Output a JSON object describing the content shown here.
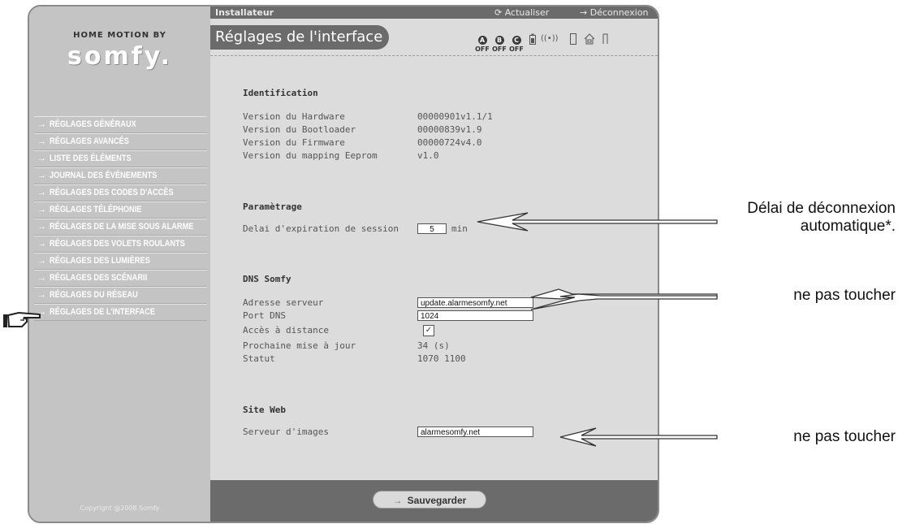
{
  "brand": {
    "line1": "HOME MOTION BY",
    "logo": "somfy."
  },
  "menu": {
    "items": [
      {
        "label": "RÉGLAGES GÉNÉRAUX"
      },
      {
        "label": "RÉGLAGES AVANCÉS"
      },
      {
        "label": "LISTE DES ÉLÉMENTS"
      },
      {
        "label": "JOURNAL DES ÉVÉNEMENTS"
      },
      {
        "label": "RÉGLAGES DES CODES D'ACCÈS"
      },
      {
        "label": "RÉGLAGES TÉLÉPHONIE"
      },
      {
        "label": "RÉGLAGES DE LA MISE SOUS ALARME"
      },
      {
        "label": "RÉGLAGES DES VOLETS ROULANTS"
      },
      {
        "label": "RÉGLAGES DES LUMIÈRES"
      },
      {
        "label": "RÉGLAGES DES SCÉNARII"
      },
      {
        "label": "RÉGLAGES DU RÉSEAU"
      },
      {
        "label": "RÉGLAGES DE L'INTERFACE"
      }
    ],
    "arrow": "→"
  },
  "copyright": "Copyright @2008 Somfy",
  "topbar": {
    "role": "Installateur",
    "refresh": "Actualiser",
    "logout": "Déconnexion"
  },
  "header": {
    "title": "Réglages de l'interface",
    "zones": [
      {
        "letter": "A",
        "state": "OFF"
      },
      {
        "letter": "B",
        "state": "OFF"
      },
      {
        "letter": "C",
        "state": "OFF"
      }
    ],
    "status_icons": [
      "battery-icon",
      "radio-signal-icon",
      "door-icon",
      "home-icon",
      "window-icon"
    ]
  },
  "identification": {
    "title": "Identification",
    "rows": [
      {
        "label": "Version du Hardware",
        "value": "00000901v1.1/1"
      },
      {
        "label": "Version du Bootloader",
        "value": "00000839v1.9"
      },
      {
        "label": "Version du Firmware",
        "value": "00000724v4.0"
      },
      {
        "label": "Version du mapping Eeprom",
        "value": "v1.0"
      }
    ]
  },
  "parametrage": {
    "title": "Paramètrage",
    "session_label": "Delai d'expiration de session",
    "session_value": "5",
    "session_unit": "min"
  },
  "dns": {
    "title": "DNS Somfy",
    "server_label": "Adresse serveur",
    "server_value": "update.alarmesomfy.net",
    "port_label": "Port DNS",
    "port_value": "1024",
    "remote_label": "Accès à distance",
    "remote_checked": true,
    "next_update_label": "Prochaine mise à jour",
    "next_update_value": "34 (s)",
    "status_label": "Statut",
    "status_value": "1070 1100"
  },
  "website": {
    "title": "Site Web",
    "image_server_label": "Serveur d'images",
    "image_server_value": "alarmesomfy.net"
  },
  "footer": {
    "save_label": "Sauvegarder",
    "save_arrow": "→"
  },
  "annotations": {
    "session_line1": "Délai de déconnexion",
    "session_line2": "automatique*.",
    "dns_note": "ne pas toucher",
    "images_note": "ne pas toucher"
  }
}
